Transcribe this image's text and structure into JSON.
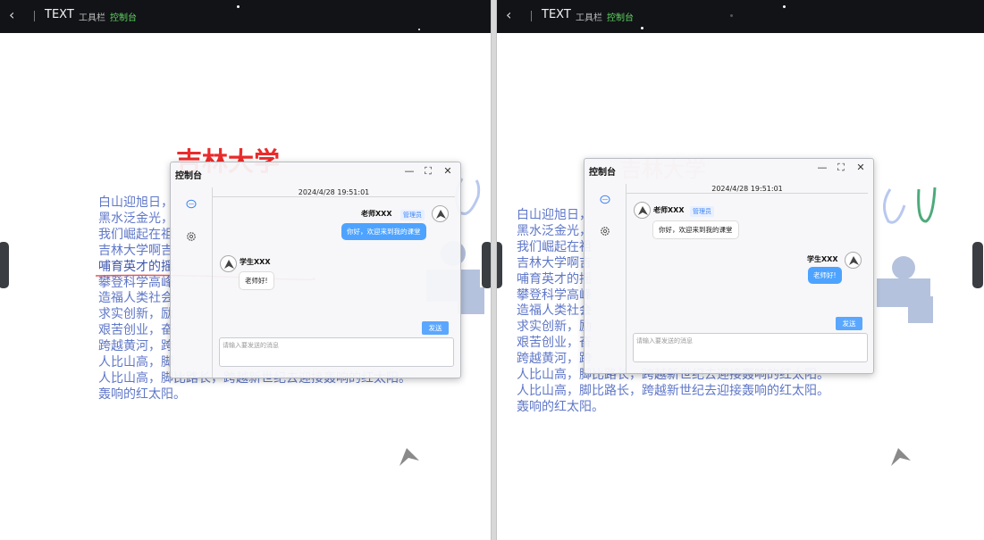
{
  "topbar": {
    "back_symbol": "‹",
    "title": "TEXT",
    "toolbar_label": "工具栏",
    "console_label": "控制台"
  },
  "left": {
    "heading": "吉林大学",
    "poem_lines": [
      "白山迎旭日，",
      "黑水泛金光，",
      "我们崛起在祖",
      "吉林大学啊吉",
      "哺育英才的摇",
      "攀登科学高峰",
      "造福人类社会",
      "求实创新，励",
      "艰苦创业，奋",
      "跨越黄河，跨",
      "人比山高，脚",
      "人比山高，脚比路长，跨越新世纪去迎接轰响的红太阳。",
      "轰响的红太阳。"
    ],
    "dialog": {
      "title": "控制台",
      "minimize_symbol": "—",
      "maximize_symbol": "⛶",
      "close_symbol": "✕",
      "datetime": "2024/4/28 19:51:01",
      "teacher": {
        "name": "老师XXX",
        "badge": "管理员",
        "message": "你好，欢迎来到我的课堂"
      },
      "student": {
        "name": "学生XXX",
        "message": "老师好!"
      },
      "send_label": "发送",
      "input_placeholder": "请输入要发送的消息"
    }
  },
  "right": {
    "heading": "吉林大学",
    "poem_lines": [
      "白山迎旭日，",
      "黑水泛金光，",
      "我们崛起在祖",
      "吉林大学啊吉",
      "哺育英才的摇",
      "攀登科学高峰",
      "造福人类社会",
      "求实创新，励",
      "艰苦创业，奋",
      "跨越黄河，跨",
      "人比山高，脚比路长，跨越新世纪去迎接轰响的红太阳。",
      "人比山高，脚比路长，跨越新世纪去迎接轰响的红太阳。",
      "轰响的红太阳。"
    ],
    "dialog": {
      "title": "控制台",
      "minimize_symbol": "—",
      "maximize_symbol": "⛶",
      "close_symbol": "✕",
      "datetime": "2024/4/28 19:51:01",
      "teacher": {
        "name": "老师XXX",
        "badge": "管理员",
        "message": "你好，欢迎来到我的课堂"
      },
      "student": {
        "name": "学生XXX",
        "message": "老师好!"
      },
      "send_label": "发送",
      "input_placeholder": "请输入要发送的消息"
    }
  },
  "icons": {
    "back": "chevron-left-icon",
    "chat": "chat-bubble-icon",
    "settings": "gear-icon",
    "avatar": "rocket-avatar-icon",
    "logo": "triangle-logo-icon"
  },
  "colors": {
    "topbar_bg": "#111317",
    "console_accent": "#5fd35f",
    "heading_red": "#ea2b2b",
    "poem_blue": "#5f77c8",
    "bubble_blue": "#4da3ff",
    "send_button": "#5aa7ff"
  }
}
